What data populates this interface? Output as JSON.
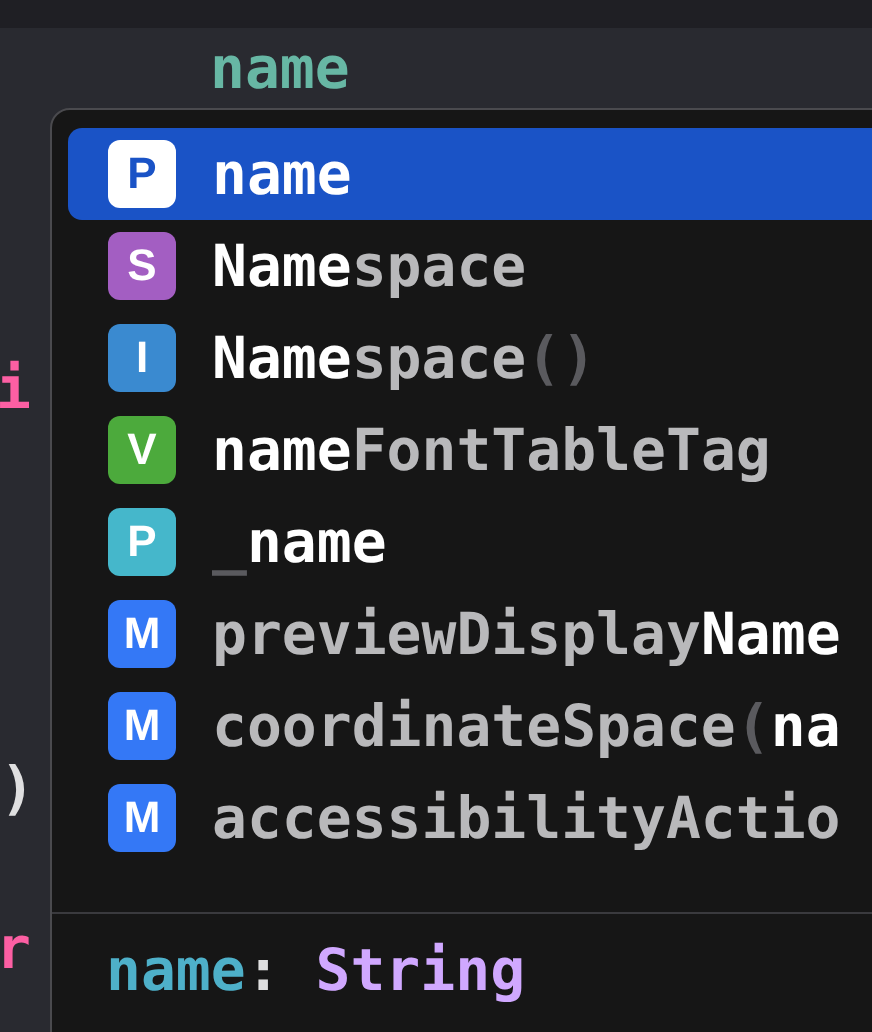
{
  "editor": {
    "fragments": [
      {
        "text": "name",
        "kind": "identifier"
      },
      {
        "text": "i",
        "kind": "keyword"
      },
      {
        "text": ")",
        "kind": "plain"
      },
      {
        "text": "r",
        "kind": "keyword"
      }
    ]
  },
  "completions": {
    "items": [
      {
        "badge": "P",
        "color": "#1a53c6",
        "selected": true,
        "segments": [
          {
            "text": "name",
            "kind": "match"
          }
        ]
      },
      {
        "badge": "S",
        "color": "#a35ec2",
        "selected": false,
        "segments": [
          {
            "text": "Name",
            "kind": "match"
          },
          {
            "text": "space",
            "kind": "rest"
          }
        ]
      },
      {
        "badge": "I",
        "color": "#3a8ad0",
        "selected": false,
        "segments": [
          {
            "text": "Name",
            "kind": "match"
          },
          {
            "text": "space",
            "kind": "rest"
          },
          {
            "text": "()",
            "kind": "punct"
          }
        ]
      },
      {
        "badge": "V",
        "color": "#4caa3c",
        "selected": false,
        "segments": [
          {
            "text": "name",
            "kind": "match"
          },
          {
            "text": "FontTableTag",
            "kind": "rest"
          }
        ]
      },
      {
        "badge": "P",
        "color": "#45b7cb",
        "selected": false,
        "segments": [
          {
            "text": "_",
            "kind": "punct"
          },
          {
            "text": "name",
            "kind": "match"
          }
        ]
      },
      {
        "badge": "M",
        "color": "#3478f6",
        "selected": false,
        "segments": [
          {
            "text": "previewDisplay",
            "kind": "rest"
          },
          {
            "text": "Name",
            "kind": "match"
          }
        ]
      },
      {
        "badge": "M",
        "color": "#3478f6",
        "selected": false,
        "segments": [
          {
            "text": "coordinateSpace",
            "kind": "rest"
          },
          {
            "text": "(",
            "kind": "punct"
          },
          {
            "text": "na",
            "kind": "match"
          }
        ]
      },
      {
        "badge": "M",
        "color": "#3478f6",
        "selected": false,
        "segments": [
          {
            "text": "accessibilityActio",
            "kind": "rest"
          }
        ]
      }
    ],
    "footer": [
      {
        "text": "name",
        "kind": "identifier"
      },
      {
        "text": ": ",
        "kind": "punct"
      },
      {
        "text": "String",
        "kind": "type"
      }
    ]
  }
}
